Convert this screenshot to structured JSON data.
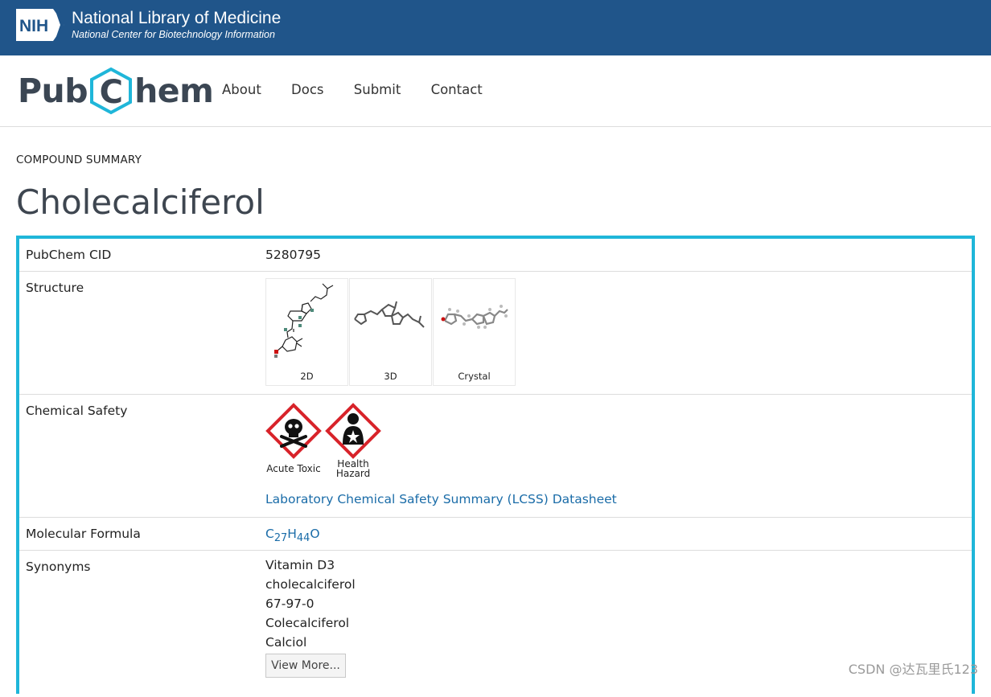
{
  "nih": {
    "badge": "NIH",
    "title": "National Library of Medicine",
    "subtitle": "National Center for Biotechnology Information"
  },
  "pubchem": {
    "logo_left": "Pub",
    "logo_hex_letter": "C",
    "logo_right": "hem",
    "nav": [
      "About",
      "Docs",
      "Submit",
      "Contact"
    ]
  },
  "page": {
    "section_label": "COMPOUND SUMMARY",
    "title": "Cholecalciferol"
  },
  "summary": {
    "cid_label": "PubChem CID",
    "cid_value": "5280795",
    "structure_label": "Structure",
    "structure_views": [
      "2D",
      "3D",
      "Crystal"
    ],
    "safety_label": "Chemical Safety",
    "hazards": [
      "Acute Toxic",
      "Health Hazard"
    ],
    "lcss_link": "Laboratory Chemical Safety Summary (LCSS) Datasheet",
    "formula_label": "Molecular Formula",
    "formula": {
      "c": "C",
      "c_sub": "27",
      "h": "H",
      "h_sub": "44",
      "o": "O"
    },
    "synonyms_label": "Synonyms",
    "synonyms": [
      "Vitamin D3",
      "cholecalciferol",
      "67-97-0",
      "Colecalciferol",
      "Calciol"
    ],
    "view_more": "View More..."
  },
  "watermark": "CSDN @达瓦里氏123",
  "colors": {
    "nih_blue": "#20558a",
    "accent_cyan": "#1fb6d9",
    "link_blue": "#1a6ca8",
    "ghs_red": "#d8232a"
  }
}
